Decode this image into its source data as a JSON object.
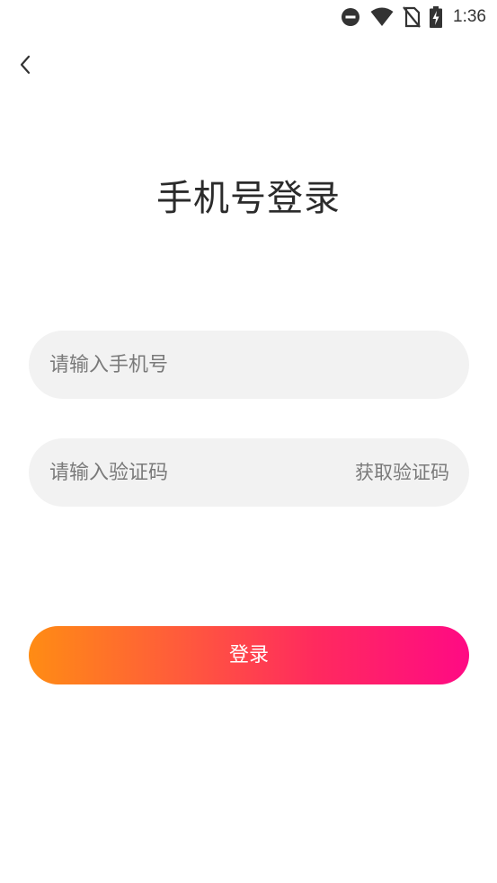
{
  "status_bar": {
    "time": "1:36",
    "icons": [
      "do-not-disturb-icon",
      "wifi-icon",
      "no-sim-icon",
      "battery-charging-icon"
    ]
  },
  "nav": {
    "back_icon": "chevron-left-icon"
  },
  "title": "手机号登录",
  "phone_input": {
    "value": "",
    "placeholder": "请输入手机号"
  },
  "code_input": {
    "value": "",
    "placeholder": "请输入验证码",
    "get_code_label": "获取验证码"
  },
  "login_button": {
    "label": "登录",
    "gradient_start": "#ff8c14",
    "gradient_end": "#ff0a84"
  }
}
